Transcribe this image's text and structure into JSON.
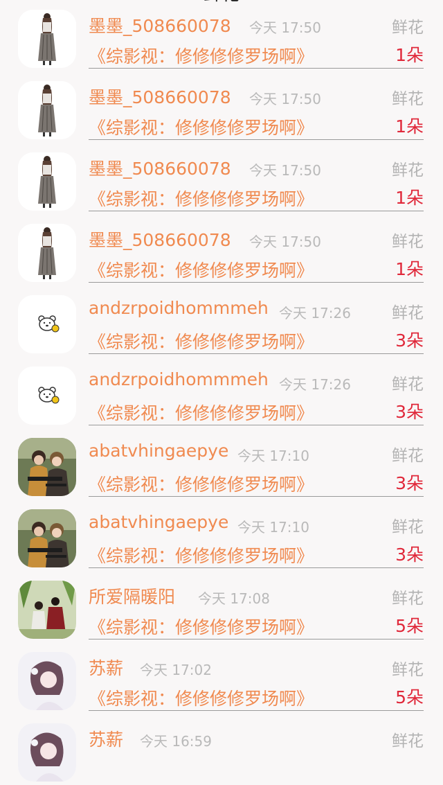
{
  "header": {
    "title": "鲜花"
  },
  "items": [
    {
      "avatar": "woman-illustration-avatar",
      "username": "墨墨_508660078",
      "time": "今天 17:50",
      "gift": "鲜花",
      "message": "《综影视：修修修修罗场啊》",
      "count": "1朵"
    },
    {
      "avatar": "woman-illustration-avatar",
      "username": "墨墨_508660078",
      "time": "今天 17:50",
      "gift": "鲜花",
      "message": "《综影视：修修修修罗场啊》",
      "count": "1朵"
    },
    {
      "avatar": "woman-illustration-avatar",
      "username": "墨墨_508660078",
      "time": "今天 17:50",
      "gift": "鲜花",
      "message": "《综影视：修修修修罗场啊》",
      "count": "1朵"
    },
    {
      "avatar": "woman-illustration-avatar",
      "username": "墨墨_508660078",
      "time": "今天 17:50",
      "gift": "鲜花",
      "message": "《综影视：修修修修罗场啊》",
      "count": "1朵"
    },
    {
      "avatar": "bear-avatar",
      "username": "andzrpoidhommmeh",
      "time": "今天 17:26",
      "gift": "鲜花",
      "message": "《综影视：修修修修罗场啊》",
      "count": "3朵"
    },
    {
      "avatar": "bear-avatar",
      "username": "andzrpoidhommmeh",
      "time": "今天 17:26",
      "gift": "鲜花",
      "message": "《综影视：修修修修罗场啊》",
      "count": "3朵"
    },
    {
      "avatar": "couple-avatar",
      "username": "abatvhingaepye",
      "time": "今天 17:10",
      "gift": "鲜花",
      "message": "《综影视：修修修修罗场啊》",
      "count": "3朵"
    },
    {
      "avatar": "couple-avatar",
      "username": "abatvhingaepye",
      "time": "今天 17:10",
      "gift": "鲜花",
      "message": "《综影视：修修修修罗场啊》",
      "count": "3朵"
    },
    {
      "avatar": "ancient-couple-avatar",
      "username": "所爱隔暖阳",
      "time": "今天 17:08",
      "gift": "鲜花",
      "message": "《综影视：修修修修罗场啊》",
      "count": "5朵"
    },
    {
      "avatar": "girl-avatar",
      "username": "苏薪",
      "time": "今天 17:02",
      "gift": "鲜花",
      "message": "《综影视：修修修修罗场啊》",
      "count": "5朵"
    },
    {
      "avatar": "girl-avatar",
      "username": "苏薪",
      "time": "今天 16:59",
      "gift": "鲜花",
      "message": "",
      "count": ""
    }
  ]
}
